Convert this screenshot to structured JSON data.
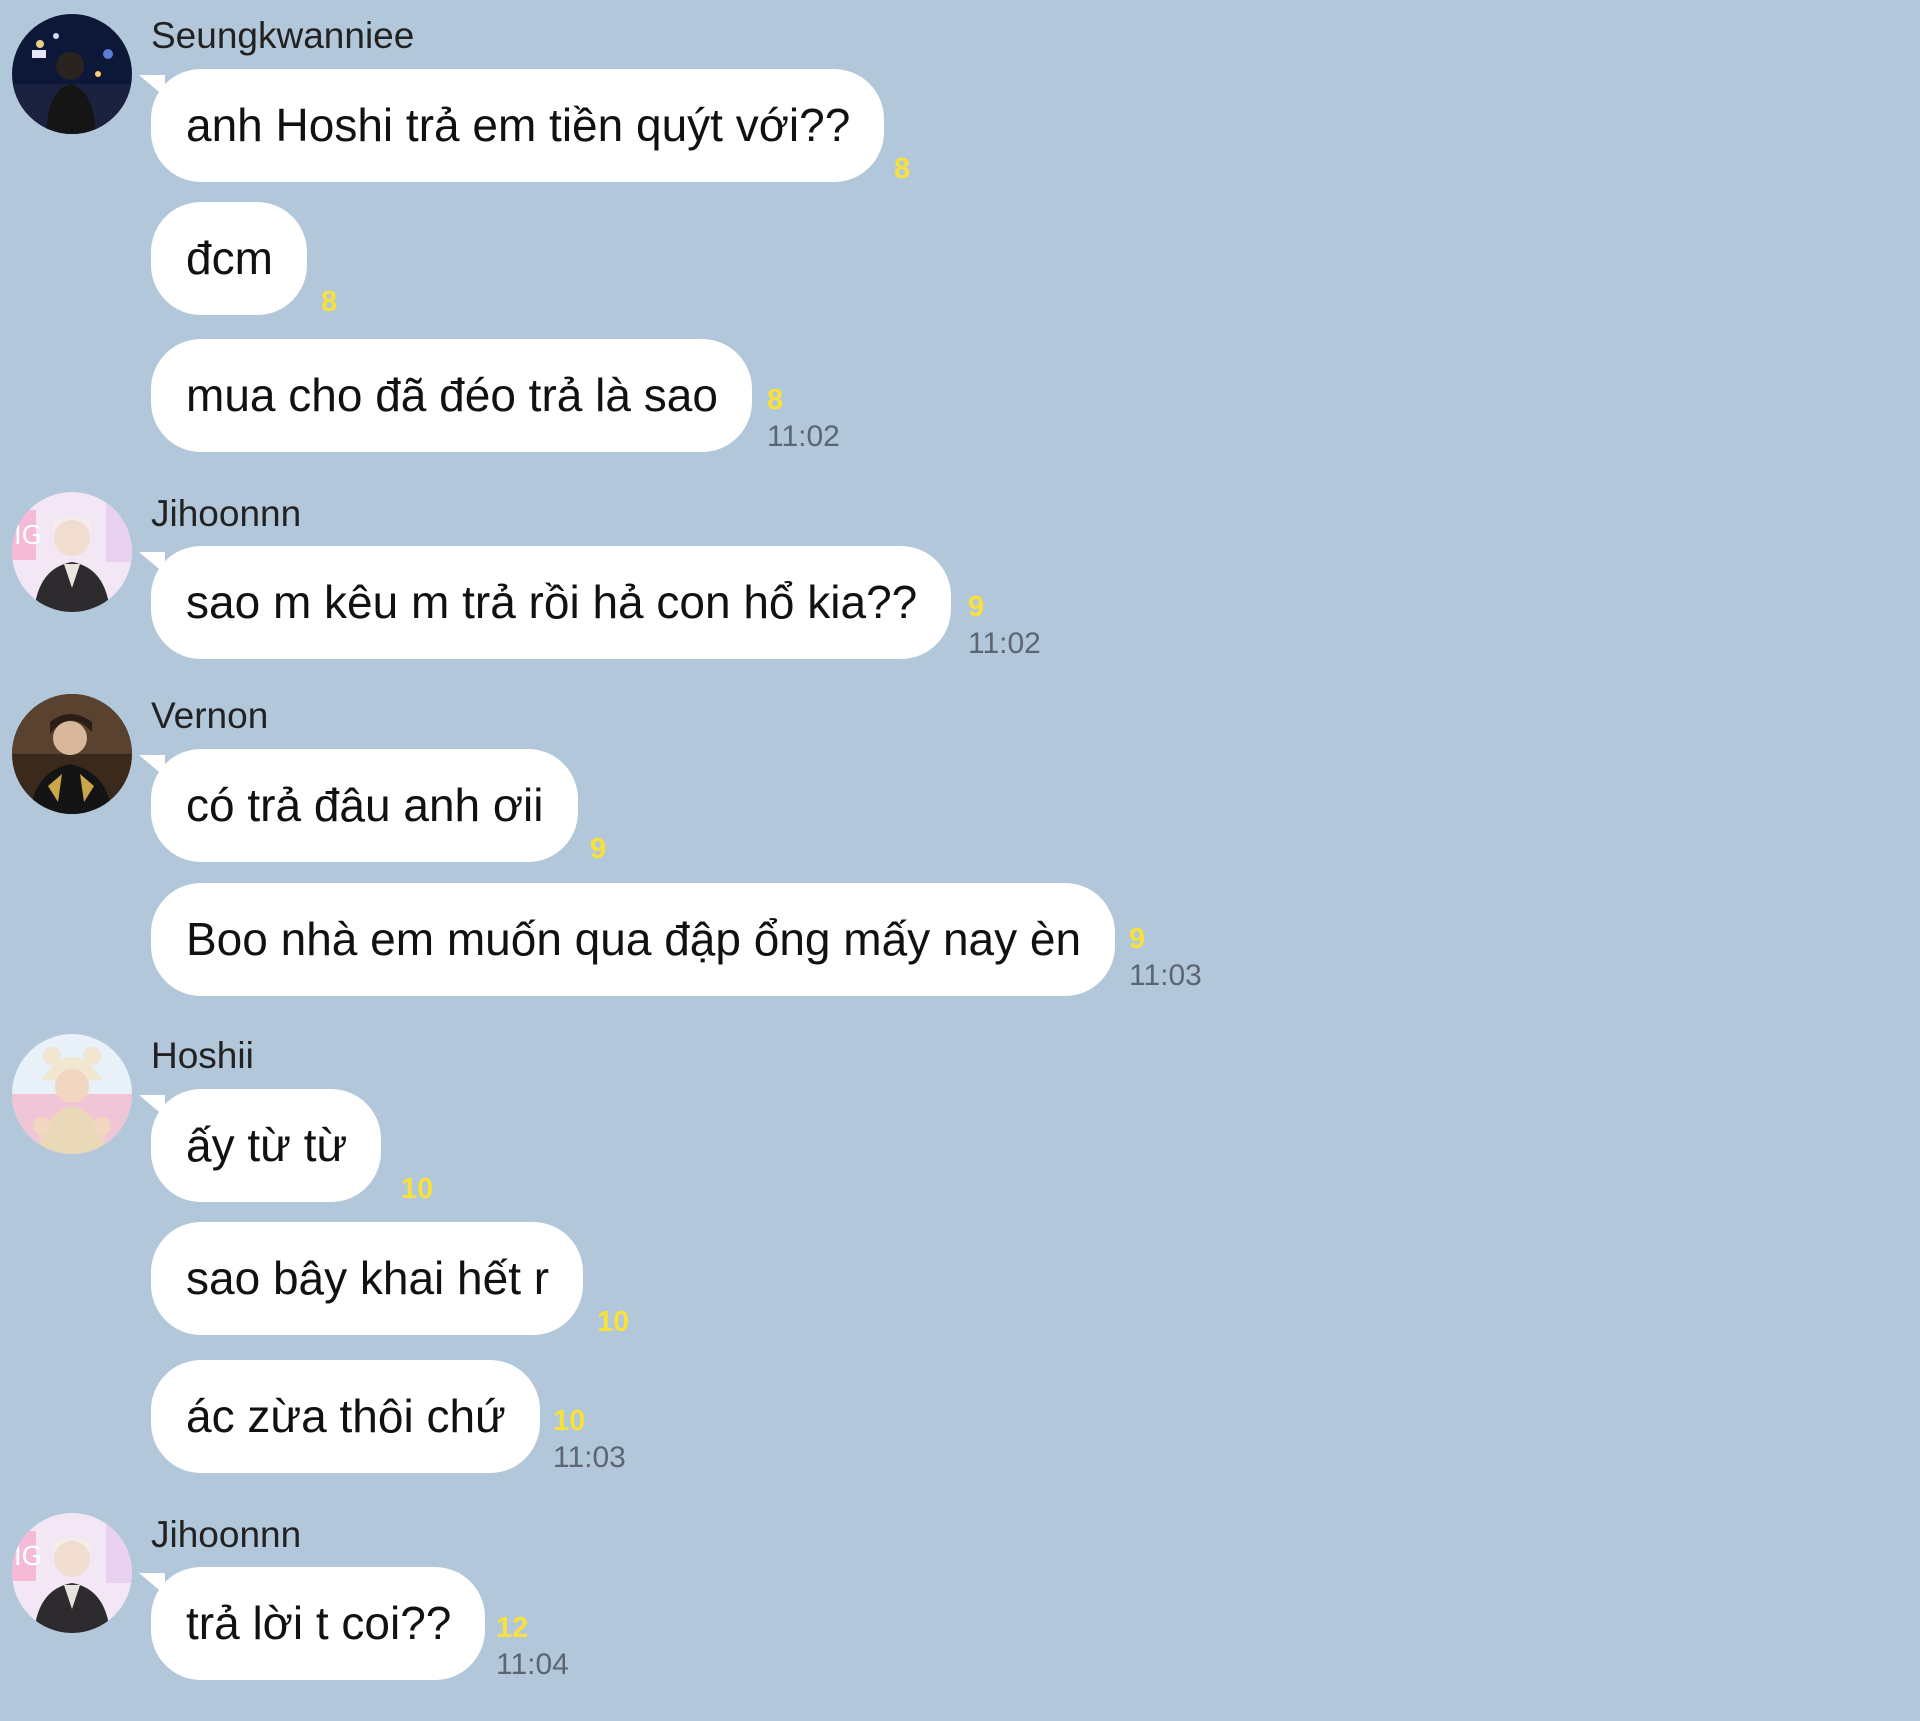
{
  "groups": [
    {
      "sender": "Seungkwanniee",
      "avatar_icon": "avatar-seungkwanniee",
      "messages": [
        {
          "text": "anh Hoshi trả em tiền quýt với??",
          "unread": "8",
          "time": ""
        },
        {
          "text": "đcm",
          "unread": "8",
          "time": ""
        },
        {
          "text": "mua cho đã đéo trả là sao",
          "unread": "8",
          "time": "11:02"
        }
      ]
    },
    {
      "sender": "Jihoonnn",
      "avatar_icon": "avatar-jihoonnn",
      "messages": [
        {
          "text": "sao m kêu m trả rồi hả con hổ kia??",
          "unread": "9",
          "time": "11:02"
        }
      ]
    },
    {
      "sender": "Vernon",
      "avatar_icon": "avatar-vernon",
      "messages": [
        {
          "text": "có trả đâu anh ơii",
          "unread": "9",
          "time": ""
        },
        {
          "text": "Boo nhà em muốn qua đập ổng mấy nay èn",
          "unread": "9",
          "time": "11:03"
        }
      ]
    },
    {
      "sender": "Hoshii",
      "avatar_icon": "avatar-hoshii",
      "messages": [
        {
          "text": "ấy từ từ",
          "unread": "10",
          "time": ""
        },
        {
          "text": "sao bây khai hết r",
          "unread": "10",
          "time": ""
        },
        {
          "text": "ác zừa thôi chứ",
          "unread": "10",
          "time": "11:03"
        }
      ]
    },
    {
      "sender": "Jihoonnn",
      "avatar_icon": "avatar-jihoonnn",
      "messages": [
        {
          "text": "trả lời t coi??",
          "unread": "12",
          "time": "11:04"
        }
      ]
    }
  ],
  "colors": {
    "background": "#b2c7da",
    "bubble": "#ffffff",
    "unread": "#f7e13a",
    "time": "#5b6672"
  }
}
